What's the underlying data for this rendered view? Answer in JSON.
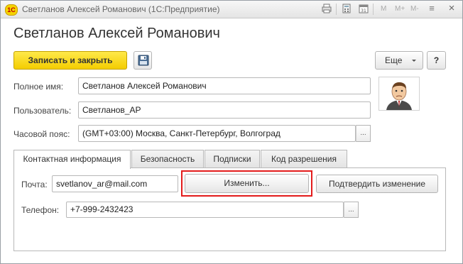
{
  "window": {
    "title": "Светланов Алексей Романович (1С:Предприятие)",
    "logo_text": "1С",
    "toolbar_icons": [
      "print-icon",
      "calculator-icon",
      "calendar-icon"
    ],
    "memory_buttons": [
      "M",
      "M+",
      "M-"
    ],
    "menu_icon": "≡",
    "close_icon": "×"
  },
  "header": {
    "title": "Светланов Алексей Романович"
  },
  "command_bar": {
    "save_close_label": "Записать и закрыть",
    "more_label": "Еще",
    "help_label": "?"
  },
  "form": {
    "full_name": {
      "label": "Полное имя:",
      "value": "Светланов Алексей Романович"
    },
    "user": {
      "label": "Пользователь:",
      "value": "Светланов_АР"
    },
    "timezone": {
      "label": "Часовой пояс:",
      "value": "(GMT+03:00) Москва, Санкт-Петербург, Волгоград",
      "choice_label": "..."
    }
  },
  "tabs": [
    {
      "label": "Контактная информация",
      "active": true
    },
    {
      "label": "Безопасность",
      "active": false
    },
    {
      "label": "Подписки",
      "active": false
    },
    {
      "label": "Код разрешения",
      "active": false
    }
  ],
  "contact": {
    "email_label": "Почта:",
    "email_value": "svetlanov_ar@mail.com",
    "change_button": "Изменить...",
    "confirm_button": "Подтвердить изменение",
    "phone_label": "Телефон:",
    "phone_value": "+7-999-2432423",
    "phone_choice_label": "..."
  },
  "colors": {
    "primary_button": "#f4cd00",
    "highlight_border": "#e31b1b"
  }
}
